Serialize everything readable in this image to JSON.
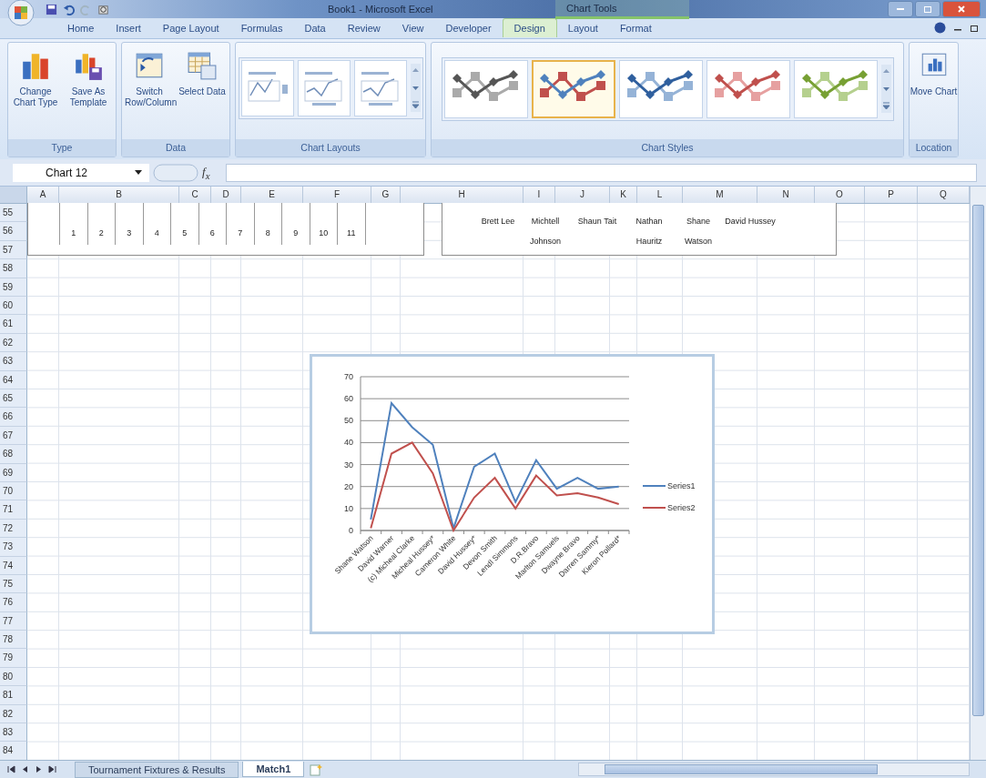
{
  "window": {
    "title": "Book1 - Microsoft Excel",
    "context_label": "Chart Tools"
  },
  "ribbon_tabs": [
    {
      "label": "Home",
      "selected": false
    },
    {
      "label": "Insert",
      "selected": false
    },
    {
      "label": "Page Layout",
      "selected": false
    },
    {
      "label": "Formulas",
      "selected": false
    },
    {
      "label": "Data",
      "selected": false
    },
    {
      "label": "Review",
      "selected": false
    },
    {
      "label": "View",
      "selected": false
    },
    {
      "label": "Developer",
      "selected": false
    },
    {
      "label": "Design",
      "selected": true
    },
    {
      "label": "Layout",
      "selected": false
    },
    {
      "label": "Format",
      "selected": false
    }
  ],
  "ribbon_groups": [
    {
      "label": "Type",
      "kind": "buttons",
      "buttons": [
        {
          "label": "Change Chart Type"
        },
        {
          "label": "Save As Template"
        }
      ]
    },
    {
      "label": "Data",
      "kind": "buttons",
      "buttons": [
        {
          "label": "Switch Row/Column"
        },
        {
          "label": "Select Data"
        }
      ]
    },
    {
      "label": "Chart Layouts",
      "kind": "layouts",
      "items": [
        {
          "selected": false
        },
        {
          "selected": false
        },
        {
          "selected": false
        }
      ]
    },
    {
      "label": "Chart Styles",
      "kind": "styles",
      "items": [
        {
          "selected": false
        },
        {
          "selected": true
        },
        {
          "selected": false
        },
        {
          "selected": false
        },
        {
          "selected": false
        }
      ]
    },
    {
      "label": "Location",
      "kind": "buttons",
      "buttons": [
        {
          "label": "Move Chart"
        }
      ]
    }
  ],
  "formula_bar": {
    "name_box": "Chart 12",
    "function_label": "f$_{x}$"
  },
  "sheet": {
    "columns": [
      "A",
      "B",
      "C",
      "D",
      "E",
      "F",
      "G",
      "H",
      "I",
      "J",
      "K",
      "L",
      "M",
      "N",
      "O",
      "P",
      "Q"
    ],
    "rows": [
      "55",
      "56",
      "57",
      "58",
      "59",
      "60",
      "61",
      "62",
      "63",
      "64",
      "65",
      "66",
      "67",
      "68",
      "69",
      "70",
      "71",
      "72",
      "73",
      "74",
      "75",
      "76",
      "77",
      "78",
      "79",
      "80",
      "81",
      "82",
      "83",
      "84"
    ],
    "number_strip": [
      "1",
      "2",
      "3",
      "4",
      "5",
      "6",
      "7",
      "8",
      "9",
      "10",
      "11"
    ],
    "name_strip": [
      "Brett Lee",
      "Michtell Johnson",
      "Shaun Tait",
      "Nathan Hauritz",
      "Shane Watson",
      "David Hussey"
    ],
    "chart": {
      "chart_data": {
        "type": "line",
        "categories": [
          "Shane Watson",
          "David Warner",
          "(c) Micheal Clarke",
          "Micheal Hussey*",
          "Cameron White",
          "David Hussey*",
          "Devon Smith",
          "Lendl Simmons",
          "D.R.Bravo",
          "Marlton Samuels",
          "Dwayne Bravo",
          "Darren Sammy*",
          "Kieron Pollard*"
        ],
        "series": [
          {
            "name": "Series1",
            "color": "#4f81bd",
            "values": [
              5,
              58,
              47,
              39,
              1,
              29,
              35,
              13,
              32,
              19,
              24,
              19,
              20
            ]
          },
          {
            "name": "Series2",
            "color": "#c0504d",
            "values": [
              1,
              35,
              40,
              26,
              0,
              15,
              24,
              10,
              25,
              16,
              17,
              15,
              12
            ]
          }
        ],
        "ylim": [
          0,
          70
        ],
        "yticks": [
          0,
          10,
          20,
          30,
          40,
          50,
          60,
          70
        ],
        "grid": true,
        "legend": true
      }
    }
  },
  "sheet_tabs": [
    {
      "label": "Tournament Fixtures & Results",
      "selected": false
    },
    {
      "label": "Match1",
      "selected": true
    }
  ]
}
